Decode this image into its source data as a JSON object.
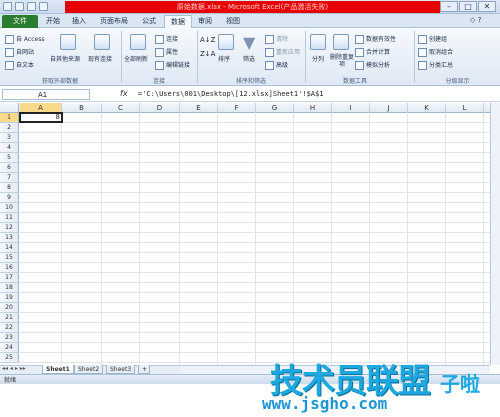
{
  "window": {
    "title": "原始数据.xlsx - Microsoft Excel(产品激活失败)",
    "minimize": "–",
    "maximize": "□",
    "close": "✕"
  },
  "tabs": [
    {
      "label": "文件",
      "active": false
    },
    {
      "label": "开始",
      "active": false
    },
    {
      "label": "插入",
      "active": false
    },
    {
      "label": "页面布局",
      "active": false
    },
    {
      "label": "公式",
      "active": false
    },
    {
      "label": "数据",
      "active": true
    },
    {
      "label": "审阅",
      "active": false
    },
    {
      "label": "视图",
      "active": false
    }
  ],
  "ribbon": {
    "external": {
      "label": "获取外部数据",
      "items": [
        "自 Access",
        "自网站",
        "自文本",
        "自其他来源",
        "现有连接"
      ]
    },
    "connections": {
      "label": "连接",
      "items": [
        "全部刷新",
        "连接",
        "属性",
        "编辑链接"
      ]
    },
    "sort": {
      "label": "排序和筛选",
      "items": [
        "排序",
        "筛选",
        "清除",
        "重新应用",
        "高级"
      ]
    },
    "tools": {
      "label": "数据工具",
      "items": [
        "分列",
        "删除重复项",
        "数据有效性",
        "合并计算",
        "模拟分析"
      ]
    },
    "outline": {
      "label": "分级显示",
      "items": [
        "创建组",
        "取消组合",
        "分类汇总"
      ]
    }
  },
  "formula_bar": {
    "name_box": "A1",
    "fx": "fx",
    "formula": "='C:\\Users\\001\\Desktop\\[12.xlsx]Sheet1'!$A$1"
  },
  "columns": [
    "A",
    "B",
    "C",
    "D",
    "E",
    "F",
    "G",
    "H",
    "I",
    "J",
    "K",
    "L"
  ],
  "rows": [
    "1",
    "2",
    "3",
    "4",
    "5",
    "6",
    "7",
    "8",
    "9",
    "10",
    "11",
    "12",
    "13",
    "14",
    "15",
    "16",
    "17",
    "18",
    "19",
    "20",
    "21",
    "22",
    "23",
    "24",
    "25"
  ],
  "cells": {
    "A1": "8"
  },
  "sheets": [
    "Sheet1",
    "Sheet2",
    "Sheet3"
  ],
  "status": "就绪",
  "watermark": {
    "text": "技术员联盟",
    "suffix": "子啦",
    "url": "www.jsgho.com"
  },
  "colors": {
    "file_tab": "#2a7c2f",
    "title_highlight": "#e60000",
    "accent": "#1da8e0"
  }
}
